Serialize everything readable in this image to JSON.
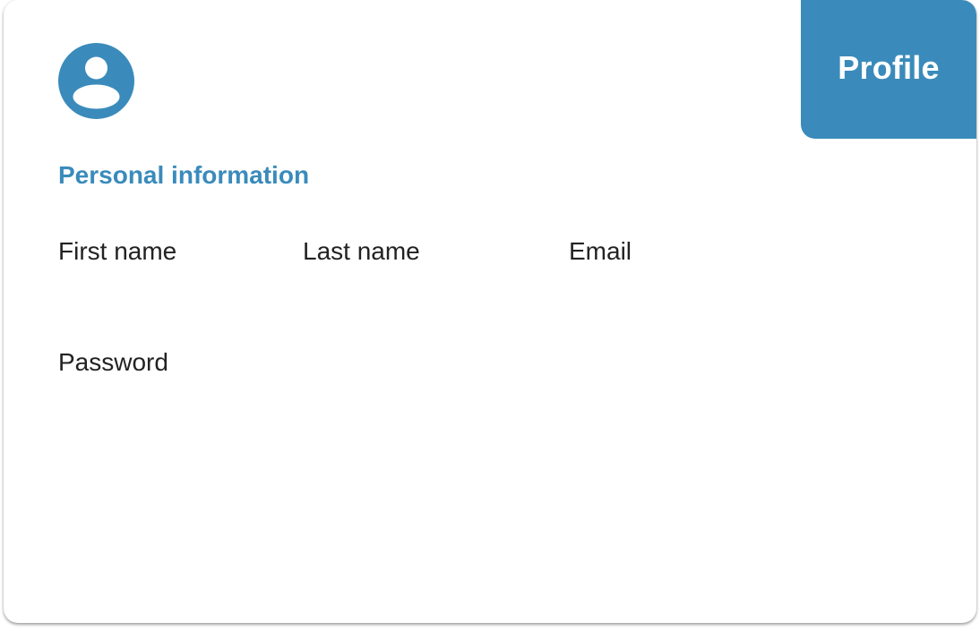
{
  "header": {
    "tab_label": "Profile"
  },
  "avatar": {
    "icon": "user-avatar-icon",
    "color": "#3a8bbb"
  },
  "section": {
    "title": "Personal information"
  },
  "fields": {
    "first_name": {
      "label": "First name",
      "value": ""
    },
    "last_name": {
      "label": "Last name",
      "value": ""
    },
    "email": {
      "label": "Email",
      "value": ""
    },
    "password": {
      "label": "Password",
      "value": ""
    }
  },
  "colors": {
    "accent": "#3a8bbb",
    "text": "#222222",
    "background": "#ffffff"
  }
}
